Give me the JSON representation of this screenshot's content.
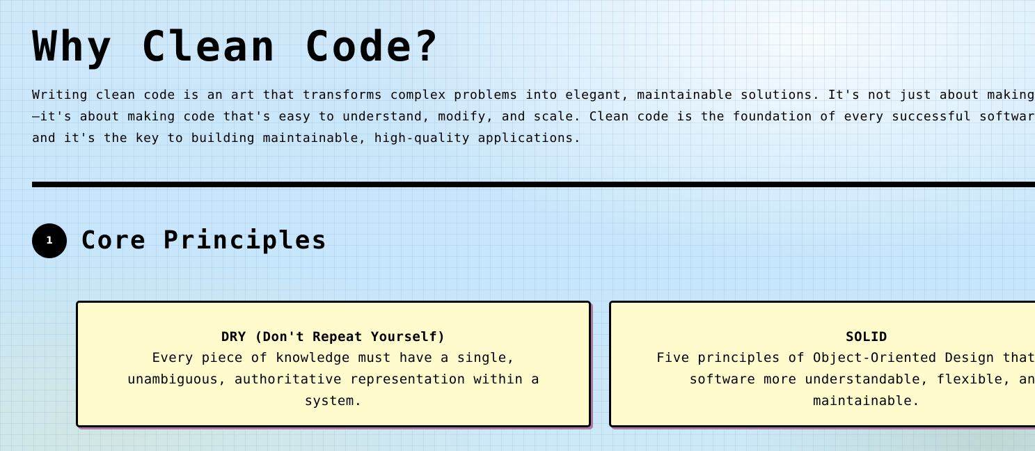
{
  "page": {
    "title": "Why Clean Code?",
    "intro": "Writing clean code is an art that transforms complex problems into elegant, maintainable solutions. It's not just about making code work—it's about making code that's easy to understand, modify, and scale. Clean code is the foundation of every successful software project, and it's the key to building maintainable, high-quality applications."
  },
  "section": {
    "number": "1",
    "title": "Core Principles"
  },
  "principles": [
    {
      "title": "DRY (Don't Repeat Yourself)",
      "description": "Every piece of knowledge must have a single, unambiguous, authoritative representation within a system."
    },
    {
      "title": "SOLID",
      "description": "Five principles of Object-Oriented Design that make software more understandable, flexible, and maintainable."
    }
  ],
  "colors": {
    "card_background": "#fffbcc",
    "card_shadow": "#b07aa8",
    "text": "#000000",
    "background": "#cfe9fa"
  }
}
